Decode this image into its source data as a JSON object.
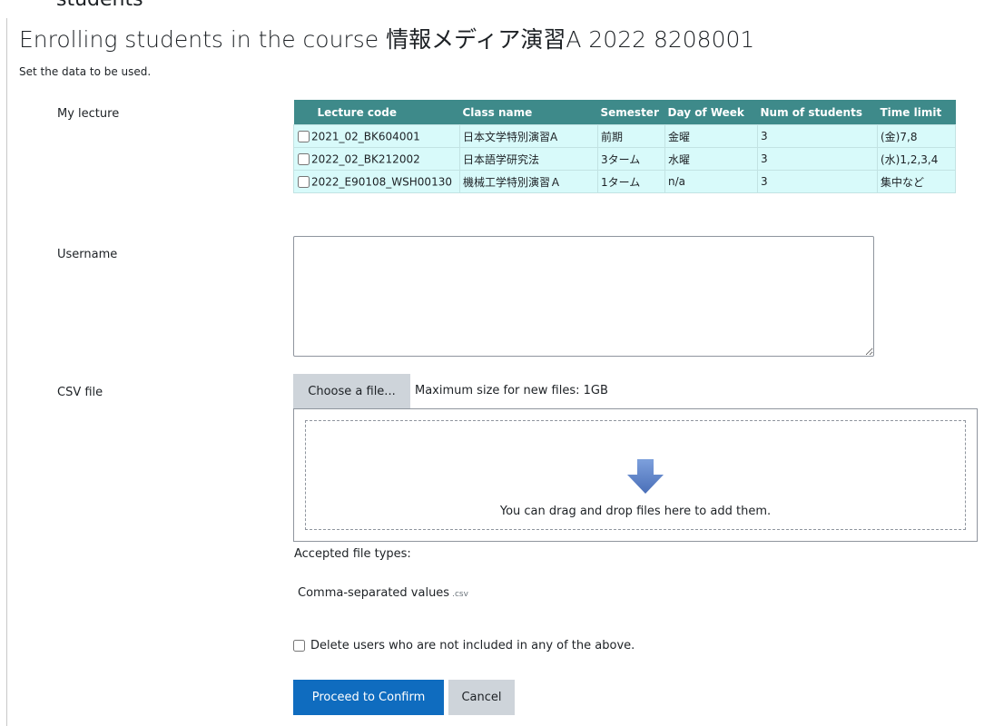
{
  "header": {
    "crumb": "students",
    "title_prefix": "Enrolling students in the course ",
    "title_course": "情報メディア演習",
    "title_suffix": "A 2022 8208001",
    "subtitle": "Set the data to be used."
  },
  "form": {
    "my_lecture_label": "My lecture",
    "username_label": "Username",
    "username_value": "",
    "csv_label": "CSV file",
    "choose_file_label": "Choose a file...",
    "max_size_text": "Maximum size for new files: 1GB",
    "drop_text": "You can drag and drop files here to add them.",
    "accepted_label": "Accepted file types:",
    "filetype_name": "Comma-separated values",
    "filetype_ext": ".csv",
    "delete_label": "Delete users who are not included in any of the above.",
    "proceed_label": "Proceed to Confirm",
    "cancel_label": "Cancel"
  },
  "lectures": {
    "headers": [
      "Lecture code",
      "Class name",
      "Semester",
      "Day of Week",
      "Num of students",
      "Time limit"
    ],
    "rows": [
      {
        "code": "2021_02_BK604001",
        "class_name": "日本文学特別演習A",
        "semester": "前期",
        "day": "金曜",
        "students": "3",
        "time_limit": "(金)7,8"
      },
      {
        "code": "2022_02_BK212002",
        "class_name": "日本語学研究法",
        "semester": "3ターム",
        "day": "水曜",
        "students": "3",
        "time_limit": "(水)1,2,3,4"
      },
      {
        "code": "2022_E90108_WSH00130",
        "class_name": "機械工学特別演習Ａ",
        "semester": "1ターム",
        "day": "n/a",
        "students": "3",
        "time_limit": "集中など"
      }
    ]
  },
  "colors": {
    "table_header_bg": "#3e8a8a",
    "table_row_bg": "#d8fafa",
    "primary_button": "#0f6cbf",
    "secondary_button": "#ced4da",
    "drop_arrow": "#5b84c9"
  },
  "icons": {
    "drop_arrow": "arrow-down-icon"
  }
}
